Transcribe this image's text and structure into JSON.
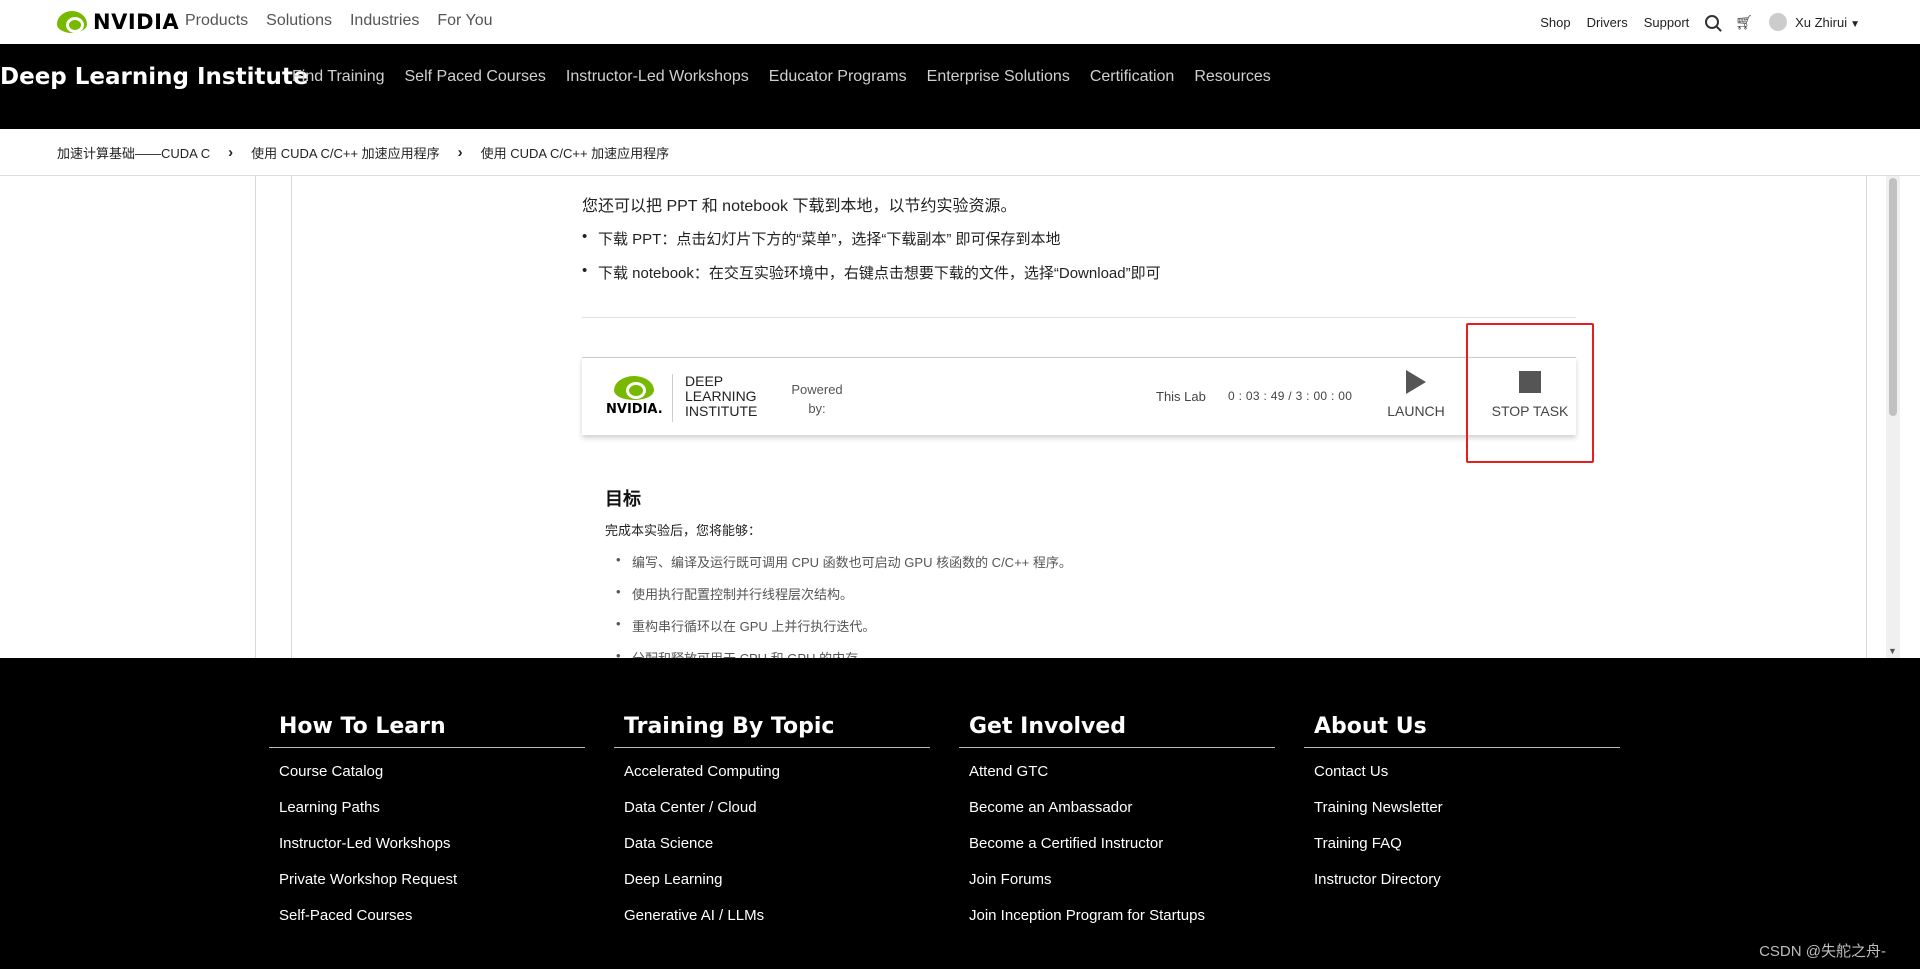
{
  "topnav": {
    "logo_text": "NVIDIA",
    "links": [
      "Products",
      "Solutions",
      "Industries",
      "For You"
    ],
    "right_links": [
      "Shop",
      "Drivers",
      "Support"
    ],
    "user_name": "Xu Zhirui"
  },
  "subnav": {
    "title": "Deep Learning Institute",
    "links": [
      "Find Training",
      "Self Paced Courses",
      "Instructor-Led Workshops",
      "Educator Programs",
      "Enterprise Solutions",
      "Certification",
      "Resources"
    ]
  },
  "breadcrumb": [
    "加速计算基础——CUDA C",
    "使用 CUDA C/C++ 加速应用程序",
    "使用 CUDA C/C++ 加速应用程序"
  ],
  "content": {
    "intro": "您还可以把 PPT 和 notebook 下载到本地，以节约实验资源。",
    "download_items": [
      "下载 PPT：点击幻灯片下方的“菜单”，选择“下载副本” 即可保存到本地",
      "下载 notebook：在交互实验环境中，右键点击想要下载的文件，选择“Download”即可"
    ],
    "lab_bar": {
      "logo_word": "NVIDIA.",
      "dli_line1": "DEEP",
      "dli_line2": "LEARNING",
      "dli_line3": "INSTITUTE",
      "powered_line1": "Powered",
      "powered_line2": "by:",
      "lab_label": "This Lab",
      "lab_time": "0 : 03 : 49 / 3 : 00 : 00",
      "launch_label": "LAUNCH",
      "stop_label": "STOP TASK"
    },
    "goals": {
      "title": "目标",
      "intro": "完成本实验后，您将能够：",
      "items": [
        "编写、编译及运行既可调用 CPU 函数也可启动 GPU 核函数的 C/C++ 程序。",
        "使用执行配置控制并行线程层次结构。",
        "重构串行循环以在 GPU 上并行执行迭代。",
        "分配和释放可用于 CPU 和 GPU 的内存。"
      ]
    }
  },
  "footer": {
    "columns": [
      {
        "title": "How To Learn",
        "items": [
          "Course Catalog",
          "Learning Paths",
          "Instructor-Led Workshops",
          "Private Workshop Request",
          "Self-Paced Courses"
        ]
      },
      {
        "title": "Training By Topic",
        "items": [
          "Accelerated Computing",
          "Data Center / Cloud",
          "Data Science",
          "Deep Learning",
          "Generative AI / LLMs"
        ]
      },
      {
        "title": "Get Involved",
        "items": [
          "Attend GTC",
          "Become an Ambassador",
          "Become a Certified Instructor",
          "Join Forums",
          "Join Inception Program for Startups"
        ]
      },
      {
        "title": "About Us",
        "items": [
          "Contact Us",
          "Training Newsletter",
          "Training FAQ",
          "Instructor Directory"
        ]
      }
    ],
    "watermark": "CSDN @失舵之舟-"
  },
  "colors": {
    "brand_green": "#76b900",
    "highlight_red": "#e3201b"
  }
}
